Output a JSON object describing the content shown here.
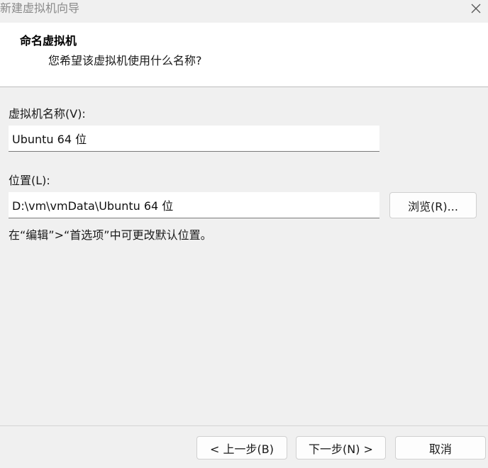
{
  "window": {
    "title": "新建虚拟机向导",
    "close_icon": "close-icon"
  },
  "header": {
    "title": "命名虚拟机",
    "subtitle": "您希望该虚拟机使用什么名称?"
  },
  "form": {
    "vm_name_label": "虚拟机名称(V):",
    "vm_name_value": "Ubuntu 64 位",
    "location_label": "位置(L):",
    "location_value": "D:\\vm\\vmData\\Ubuntu 64 位",
    "browse_label": "浏览(R)...",
    "hint": "在“编辑”>“首选项”中可更改默认位置。"
  },
  "footer": {
    "back_label": "< 上一步(B)",
    "next_label": "下一步(N) >",
    "cancel_label": "取消"
  }
}
